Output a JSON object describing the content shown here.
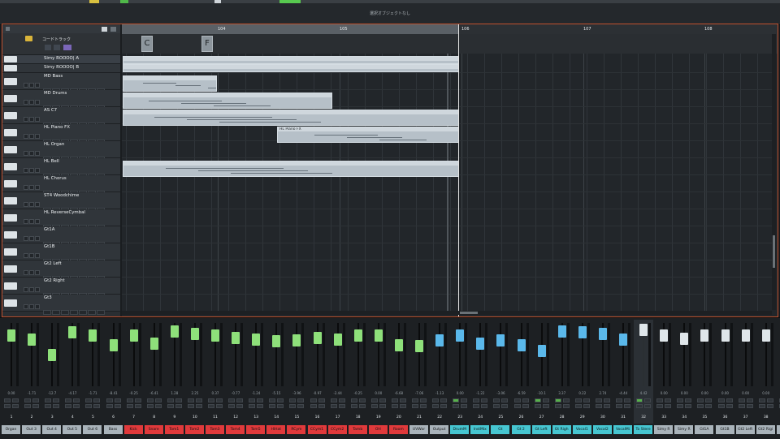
{
  "window": {
    "title": "選択オブジェクトなし"
  },
  "chord_track": {
    "name": "コードトラック",
    "chords": [
      "C",
      "F"
    ]
  },
  "ruler": {
    "bars": [
      "104",
      "105",
      "106",
      "107",
      "108"
    ]
  },
  "tracks": [
    {
      "name": "Simy ROOOO| A",
      "selected": true
    },
    {
      "name": "Simy ROOOO| B"
    },
    {
      "name": "MD Bass"
    },
    {
      "name": "MD Drums"
    },
    {
      "name": "AS C7"
    },
    {
      "name": "HL Piano FX"
    },
    {
      "name": "HL Organ"
    },
    {
      "name": "HL Bell"
    },
    {
      "name": "HL Chorus"
    },
    {
      "name": "ST4 Woodchime"
    },
    {
      "name": "HL ReverseCymbal"
    },
    {
      "name": "Gt1A"
    },
    {
      "name": "Gt1B"
    },
    {
      "name": "Gt2 Left"
    },
    {
      "name": "Gt2 Right"
    },
    {
      "name": "Gt3"
    }
  ],
  "parts": [
    {
      "label": ""
    },
    {
      "label": ""
    },
    {
      "label": ""
    },
    {
      "label": ""
    },
    {
      "label": ""
    },
    {
      "label": "HL Piano FX"
    },
    {
      "label": ""
    }
  ],
  "colors": {
    "accent": "#c0522e",
    "fader_green": "#8ee07a",
    "fader_blue": "#5ab8ea",
    "fader_white": "#dfe6ea",
    "red": "#e0393b",
    "cyan": "#46c6d1",
    "grey": "#a9b3ba"
  },
  "mixer": {
    "channels": [
      {
        "num": "1",
        "name": "Organ",
        "val": "0.00",
        "color": "grey",
        "fader": 0.88,
        "cap": "green"
      },
      {
        "num": "2",
        "name": "Out 3",
        "val": "-1.71",
        "color": "grey",
        "fader": 0.82,
        "cap": "green"
      },
      {
        "num": "3",
        "name": "Out 4",
        "val": "-12.7",
        "color": "grey",
        "fader": 0.55,
        "cap": "green"
      },
      {
        "num": "4",
        "name": "Out 5",
        "val": "-4.17",
        "color": "grey",
        "fader": 0.95,
        "cap": "green"
      },
      {
        "num": "5",
        "name": "Out 6",
        "val": "-1.71",
        "color": "grey",
        "fader": 0.88,
        "cap": "green"
      },
      {
        "num": "6",
        "name": "Bass",
        "val": "-8.41",
        "color": "grey",
        "fader": 0.72,
        "cap": "green"
      },
      {
        "num": "7",
        "name": "Kick",
        "val": "-0.25",
        "color": "red",
        "fader": 0.88,
        "cap": "green"
      },
      {
        "num": "8",
        "name": "Snare",
        "val": "-6.41",
        "color": "red",
        "fader": 0.75,
        "cap": "green"
      },
      {
        "num": "9",
        "name": "Tom1",
        "val": "1.28",
        "color": "red",
        "fader": 0.96,
        "cap": "green"
      },
      {
        "num": "10",
        "name": "Tom2",
        "val": "2.25",
        "color": "red",
        "fader": 0.92,
        "cap": "green"
      },
      {
        "num": "11",
        "name": "Tom3",
        "val": "0.37",
        "color": "red",
        "fader": 0.88,
        "cap": "green"
      },
      {
        "num": "12",
        "name": "Tom4",
        "val": "-0.77",
        "color": "red",
        "fader": 0.85,
        "cap": "green"
      },
      {
        "num": "13",
        "name": "Tom5",
        "val": "-1.24",
        "color": "red",
        "fader": 0.82,
        "cap": "green"
      },
      {
        "num": "14",
        "name": "HiHat",
        "val": "-5.15",
        "color": "red",
        "fader": 0.78,
        "cap": "green"
      },
      {
        "num": "15",
        "name": "RCym",
        "val": "-3.96",
        "color": "red",
        "fader": 0.8,
        "cap": "green"
      },
      {
        "num": "16",
        "name": "CCym1",
        "val": "-0.97",
        "color": "red",
        "fader": 0.85,
        "cap": "green"
      },
      {
        "num": "17",
        "name": "CCym2",
        "val": "-2.44",
        "color": "red",
        "fader": 0.81,
        "cap": "green"
      },
      {
        "num": "18",
        "name": "Tamb",
        "val": "-0.25",
        "color": "red",
        "fader": 0.88,
        "cap": "green"
      },
      {
        "num": "19",
        "name": "OH",
        "val": "0.00",
        "color": "red",
        "fader": 0.88,
        "cap": "green"
      },
      {
        "num": "20",
        "name": "Room",
        "val": "-6.68",
        "color": "red",
        "fader": 0.72,
        "cap": "green"
      },
      {
        "num": "21",
        "name": "UVWor",
        "val": "-7.06",
        "color": "grey",
        "fader": 0.7,
        "cap": "green"
      },
      {
        "num": "22",
        "name": "Output",
        "val": "-1.13",
        "color": "grey",
        "fader": 0.8,
        "cap": "blue"
      },
      {
        "num": "23",
        "name": "DrumM",
        "val": "0.00",
        "color": "cyan",
        "fader": 0.88,
        "cap": "blue"
      },
      {
        "num": "24",
        "name": "InstMix",
        "val": "-1.22",
        "color": "cyan",
        "fader": 0.74,
        "cap": "blue"
      },
      {
        "num": "25",
        "name": "Gt",
        "val": "-3.06",
        "color": "cyan",
        "fader": 0.8,
        "cap": "blue"
      },
      {
        "num": "26",
        "name": "Gt 2",
        "val": "-6.59",
        "color": "cyan",
        "fader": 0.72,
        "cap": "blue"
      },
      {
        "num": "27",
        "name": "Gt Left",
        "val": "-10.1",
        "color": "cyan",
        "fader": 0.62,
        "cap": "blue"
      },
      {
        "num": "28",
        "name": "Gt Righ",
        "val": "3.37",
        "color": "cyan",
        "fader": 0.96,
        "cap": "blue"
      },
      {
        "num": "29",
        "name": "Vocal1",
        "val": "0.22",
        "color": "cyan",
        "fader": 0.95,
        "cap": "blue"
      },
      {
        "num": "30",
        "name": "Vocal2",
        "val": "2.74",
        "color": "cyan",
        "fader": 0.92,
        "cap": "blue"
      },
      {
        "num": "31",
        "name": "VocalMi",
        "val": "-4.44",
        "color": "cyan",
        "fader": 0.82,
        "cap": "blue"
      },
      {
        "num": "32",
        "name": "To Stere",
        "val": "4.42",
        "color": "cyan",
        "fader": 0.98,
        "cap": "white"
      },
      {
        "num": "33",
        "name": "Simy R",
        "val": "0.00",
        "color": "grey",
        "fader": 0.88,
        "cap": "white"
      },
      {
        "num": "34",
        "name": "Simy R",
        "val": "0.00",
        "color": "grey",
        "fader": 0.83,
        "cap": "white"
      },
      {
        "num": "35",
        "name": "Gt1A",
        "val": "0.00",
        "color": "grey",
        "fader": 0.88,
        "cap": "white"
      },
      {
        "num": "36",
        "name": "Gt1B",
        "val": "0.00",
        "color": "grey",
        "fader": 0.88,
        "cap": "white"
      },
      {
        "num": "37",
        "name": "Gt2 Left",
        "val": "0.00",
        "color": "grey",
        "fader": 0.88,
        "cap": "white"
      },
      {
        "num": "38",
        "name": "Gt2 Rigi",
        "val": "0.00",
        "color": "grey",
        "fader": 0.88,
        "cap": "white"
      },
      {
        "num": "39",
        "name": "Gt3",
        "val": "0.00",
        "color": "grey",
        "fader": 0.88,
        "cap": "white"
      }
    ]
  }
}
